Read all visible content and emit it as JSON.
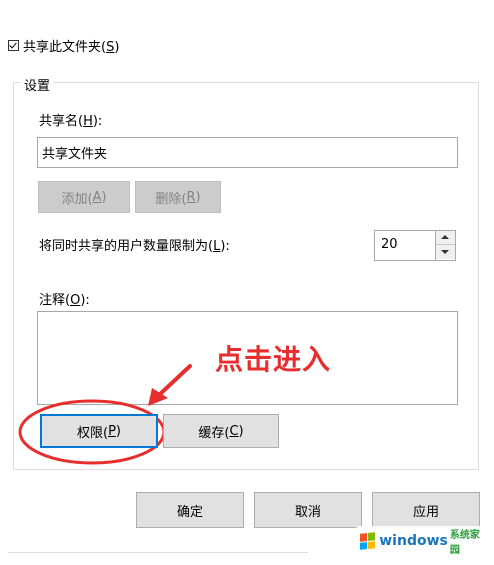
{
  "share_checkbox": {
    "label": "共享此文件夹(",
    "key": "S",
    "suffix": ")",
    "checked": true
  },
  "settings_group": {
    "title": "设置"
  },
  "share_name": {
    "label": "共享名(",
    "key": "H",
    "suffix": "):",
    "value": "共享文件夹"
  },
  "add_button": {
    "label": "添加(",
    "key": "A",
    "suffix": ")"
  },
  "remove_button": {
    "label": "删除(",
    "key": "R",
    "suffix": ")"
  },
  "user_limit": {
    "label": "将同时共享的用户数量限制为(",
    "key": "L",
    "suffix": "):",
    "value": "20"
  },
  "comment": {
    "label": "注释(",
    "key": "O",
    "suffix": "):",
    "value": ""
  },
  "permissions_button": {
    "label": "权限(",
    "key": "P",
    "suffix": ")"
  },
  "cache_button": {
    "label": "缓存(",
    "key": "C",
    "suffix": ")"
  },
  "dialog_buttons": {
    "ok": "确定",
    "cancel": "取消",
    "apply": "应用"
  },
  "annotation": {
    "text": "点击进入",
    "color": "#e62e2e"
  },
  "watermark": {
    "word": "windows",
    "site": "系统家园"
  },
  "colors": {
    "accent": "#0078d7",
    "annotation_red": "#e62e2e"
  }
}
